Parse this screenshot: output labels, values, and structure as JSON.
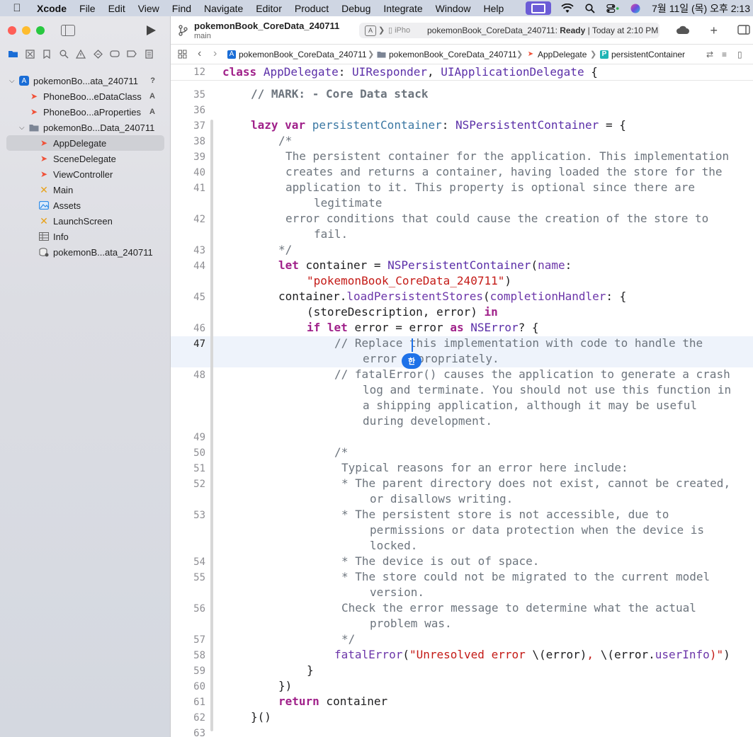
{
  "menubar": {
    "app": "Xcode",
    "items": [
      "File",
      "Edit",
      "View",
      "Find",
      "Navigate",
      "Editor",
      "Product",
      "Debug",
      "Integrate",
      "Window",
      "Help"
    ],
    "clock": "7월 11일 (목) 오후 2:13",
    "icons": [
      "apple-icon",
      "screen-share-icon",
      "wifi-icon",
      "spotlight-icon",
      "control-center-icon",
      "siri-icon"
    ]
  },
  "sidebar": {
    "tree": [
      {
        "label": "pokemonBo...ata_240711",
        "badge": "?",
        "icon": "project-icon",
        "depth": 0,
        "disclosure": "open"
      },
      {
        "label": "PhoneBoo...eDataClass",
        "badge": "A",
        "icon": "swift-file-icon",
        "depth": 1
      },
      {
        "label": "PhoneBoo...aProperties",
        "badge": "A",
        "icon": "swift-file-icon",
        "depth": 1
      },
      {
        "label": "pokemonBo...Data_240711",
        "badge": "",
        "icon": "folder-icon",
        "depth": 1,
        "disclosure": "open"
      },
      {
        "label": "AppDelegate",
        "badge": "",
        "icon": "swift-file-icon",
        "depth": 2,
        "selected": true
      },
      {
        "label": "SceneDelegate",
        "badge": "",
        "icon": "swift-file-icon",
        "depth": 2
      },
      {
        "label": "ViewController",
        "badge": "",
        "icon": "swift-file-icon",
        "depth": 2
      },
      {
        "label": "Main",
        "badge": "",
        "icon": "storyboard-icon",
        "depth": 2
      },
      {
        "label": "Assets",
        "badge": "",
        "icon": "assets-icon",
        "depth": 2
      },
      {
        "label": "LaunchScreen",
        "badge": "",
        "icon": "storyboard-icon",
        "depth": 2
      },
      {
        "label": "Info",
        "badge": "",
        "icon": "plist-icon",
        "depth": 2
      },
      {
        "label": "pokemonB...ata_240711",
        "badge": "",
        "icon": "coredata-model-icon",
        "depth": 2
      }
    ]
  },
  "toolbar": {
    "project_title": "pokemonBook_CoreData_240711",
    "branch": "main",
    "device": "iPho",
    "status_project": "pokemonBook_CoreData_240711:",
    "status_state": "Ready",
    "status_time": "| Today at 2:10 PM"
  },
  "jumpbar": {
    "crumbs": [
      "pokemonBook_CoreData_240711",
      "pokemonBook_CoreData_240711",
      "AppDelegate",
      "persistentContainer"
    ]
  },
  "editor": {
    "sticky_line": "12",
    "ime_indicator": "한",
    "current_line": "47",
    "line_numbers": [
      "35",
      "36",
      "37",
      "38",
      "39",
      "40",
      "41",
      "42",
      "43",
      "44",
      "45",
      "46",
      "47",
      "48",
      "49",
      "50",
      "51",
      "52",
      "53",
      "54",
      "55",
      "56",
      "57",
      "58",
      "59",
      "60",
      "61",
      "62",
      "63"
    ],
    "code": {
      "l12": [
        "class",
        " ",
        "AppDelegate",
        ": ",
        "UIResponder",
        ", ",
        "UIApplicationDelegate",
        " {"
      ],
      "l35": "// MARK: - Core Data stack",
      "l37": [
        "lazy",
        " ",
        "var",
        " ",
        "persistentContainer",
        ": ",
        "NSPersistentContainer",
        " = {"
      ],
      "l38": "/*",
      "l39": "The persistent container for the application. This implementation",
      "l40": "creates and returns a container, having loaded the store for the",
      "l41a": "application to it. This property is optional since there are",
      "l41b": "legitimate",
      "l42a": "error conditions that could cause the creation of the store to",
      "l42b": "fail.",
      "l43": "*/",
      "l44a": [
        "let",
        " container = ",
        "NSPersistentContainer",
        "(",
        "name",
        ":"
      ],
      "l44b": "\"pokemonBook_CoreData_240711\"",
      "l44c": ")",
      "l45a": [
        "container.",
        "loadPersistentStores",
        "(",
        "completionHandler",
        ": {"
      ],
      "l45b": [
        "(storeDescription, error) ",
        "in"
      ],
      "l46": [
        "if",
        " ",
        "let",
        " error = error ",
        "as",
        " ",
        "NSError",
        "? {"
      ],
      "l47a": "// Replace this implementation with code to handle the",
      "l47b": "error appropriately.",
      "l48a": "// fatalError() causes the application to generate a crash",
      "l48b": "log and terminate. You should not use this function in",
      "l48c": "a shipping application, although it may be useful",
      "l48d": "during development.",
      "l50": "/*",
      "l51": "Typical reasons for an error here include:",
      "l52a": "* The parent directory does not exist, cannot be created,",
      "l52b": "or disallows writing.",
      "l53a": "* The persistent store is not accessible, due to",
      "l53b": "permissions or data protection when the device is",
      "l53c": "locked.",
      "l54": "* The device is out of space.",
      "l55a": "* The store could not be migrated to the current model",
      "l55b": "version.",
      "l56a": "Check the error message to determine what the actual",
      "l56b": "problem was.",
      "l57": "*/",
      "l58": [
        "fatalError",
        "(",
        "\"Unresolved error ",
        "\\(error)",
        ", ",
        "\\(error.",
        "userInfo",
        ")\"",
        ")"
      ],
      "l59": "}",
      "l60": "})",
      "l61": [
        "return",
        " container"
      ],
      "l62": "}()"
    }
  },
  "colors": {
    "keyword": "#a0218a",
    "type": "#5b2fa8",
    "identifier": "#3a77a3",
    "comment": "#6c747d",
    "string": "#c41a16",
    "accent": "#1e72e8"
  }
}
